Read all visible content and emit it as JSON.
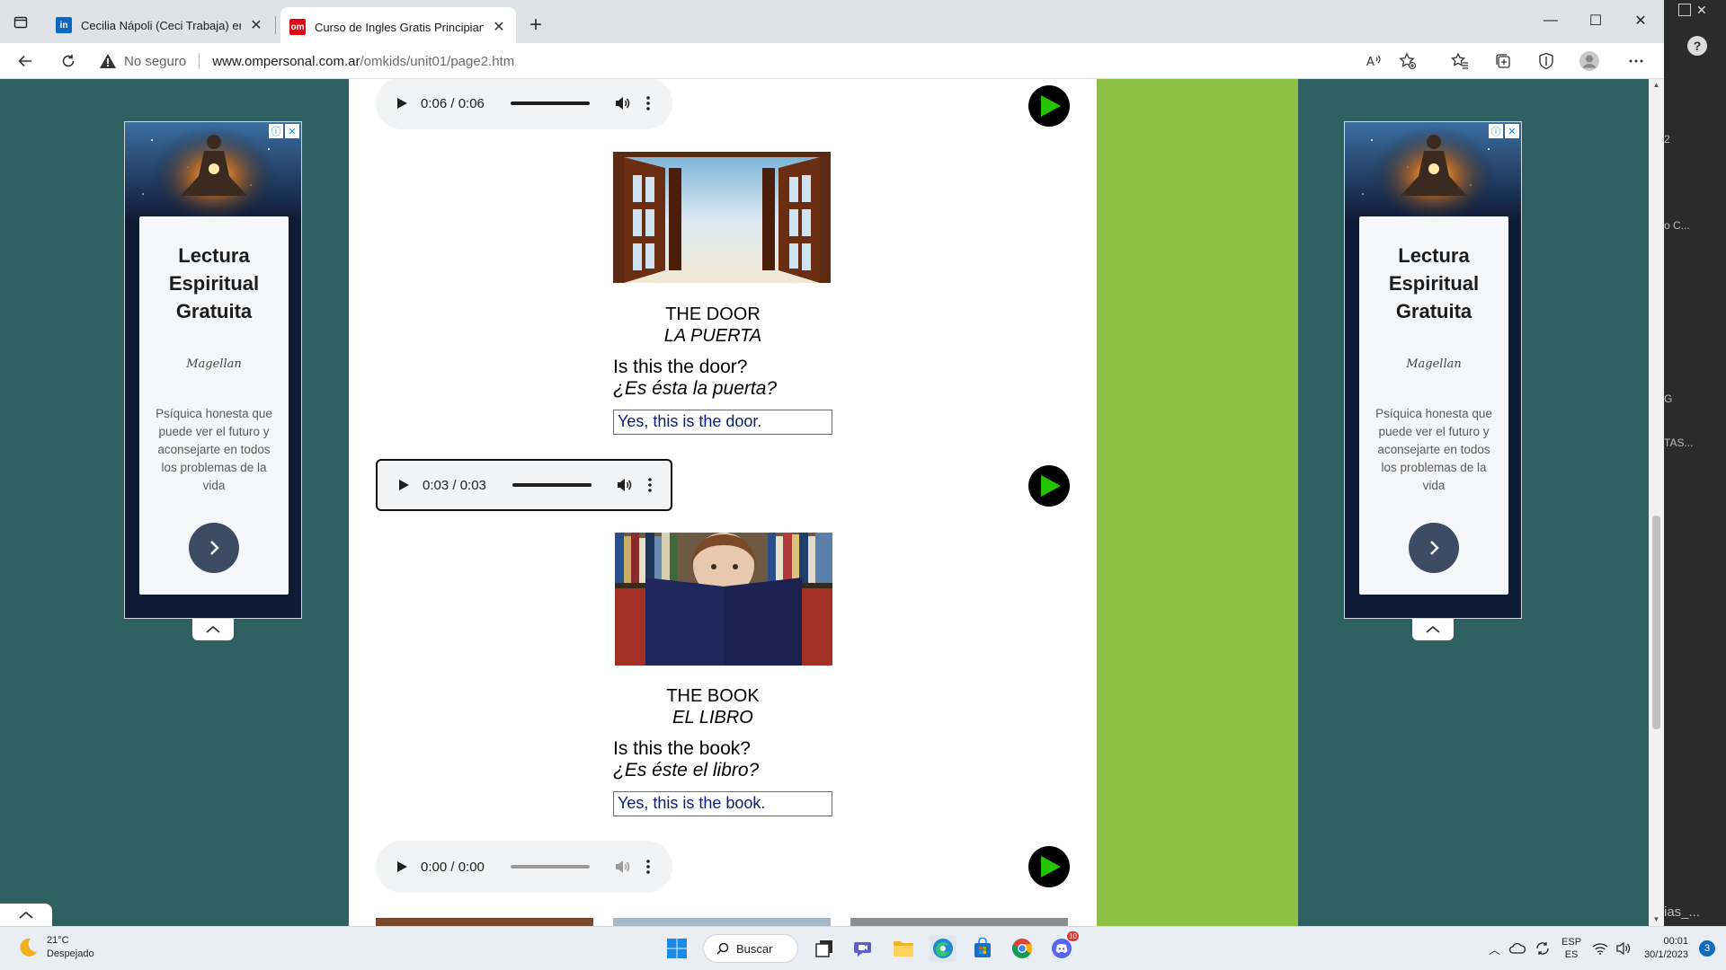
{
  "browser": {
    "tabs": [
      {
        "title": "Cecilia Nápoli (Ceci Trabaja) en L",
        "favicon": "linkedin-icon",
        "active": false
      },
      {
        "title": "Curso de Ingles Gratis Principiant",
        "favicon": "om",
        "active": true
      }
    ],
    "address": {
      "security_label": "No seguro",
      "host": "www.ompersonal.com.ar",
      "path": "/omkids/unit01/page2.htm"
    }
  },
  "ads": {
    "title_lines": [
      "Lectura",
      "Espiritual",
      "Gratuita"
    ],
    "brand": "Magellan",
    "description": "Psíquica honesta que puede ver el futuro y aconsejarte en todos los problemas de la vida"
  },
  "lessons": [
    {
      "audio": {
        "time": "0:06 / 0:06"
      },
      "image": "door-image",
      "word_en": "THE DOOR",
      "word_es": "LA PUERTA",
      "question_en": "Is this the door?",
      "question_es": "¿Es ésta la puerta?",
      "answer": "Yes, this is the door."
    },
    {
      "audio": {
        "time": "0:03 / 0:03"
      },
      "image": "book-image",
      "word_en": "THE BOOK",
      "word_es": "EL LIBRO",
      "question_en": "Is this the book?",
      "question_es": "¿Es éste el libro?",
      "answer": "Yes, this is the book."
    },
    {
      "audio": {
        "time": "0:00 / 0:00"
      }
    }
  ],
  "taskbar": {
    "weather_temp": "21°C",
    "weather_desc": "Despejado",
    "search_label": "Buscar",
    "chat_badge": "10",
    "lang_top": "ESP",
    "lang_bottom": "ES",
    "time": "00:01",
    "date": "30/1/2023",
    "notifications": "3"
  },
  "side_panel": {
    "items": [
      "2",
      "o C...",
      "G",
      "TAS...",
      "ias_..."
    ]
  },
  "colors": {
    "page_bg": "#2e5f61",
    "green_strip": "#8dc044",
    "answer_text": "#0a1a7a",
    "play_green": "#22c400"
  }
}
